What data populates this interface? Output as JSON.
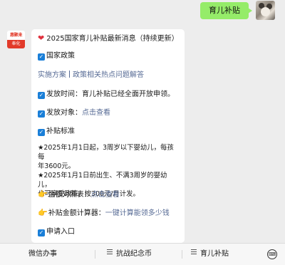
{
  "outgoing_message": "育儿补贴",
  "bot_avatar": {
    "top_text": "惠聚来",
    "bottom_text": "奉化"
  },
  "card": {
    "title": "2025国家育儿补贴最新消息（持续更新）",
    "policy_heading": "国家政策",
    "links": [
      "实施方案",
      "政策相关热点问题解答"
    ],
    "release_time_label": "发放时间：",
    "release_time_value": "育儿补贴已经全面开放申领。",
    "target_label": "发放对象：",
    "target_link": "点击查看",
    "standard_heading": "补贴标准",
    "standard_line1": "★2025年1月1日起，3周岁以下婴幼儿，每孩每",
    "standard_line2": "年3600元。",
    "standard_line3": "★2025年1月1日前出生、不满3周岁的婴幼儿，",
    "standard_line4": "也可享受政策，按300元/月计发。",
    "amount_table_label": "金额对照表：",
    "amount_table_link": "点击查看",
    "calculator_label": "补贴金额计算器：",
    "calculator_link": "一键计算能领多少钱",
    "apply_heading": "申请入口"
  },
  "menu": {
    "items": [
      "微信办事",
      "抗战纪念币",
      "育儿补贴"
    ],
    "keyboard_icon": "keyboard-icon"
  },
  "colors": {
    "accent_green": "#95ec69",
    "link_blue": "#576b95",
    "checkbox_blue": "#1a7fd8"
  }
}
